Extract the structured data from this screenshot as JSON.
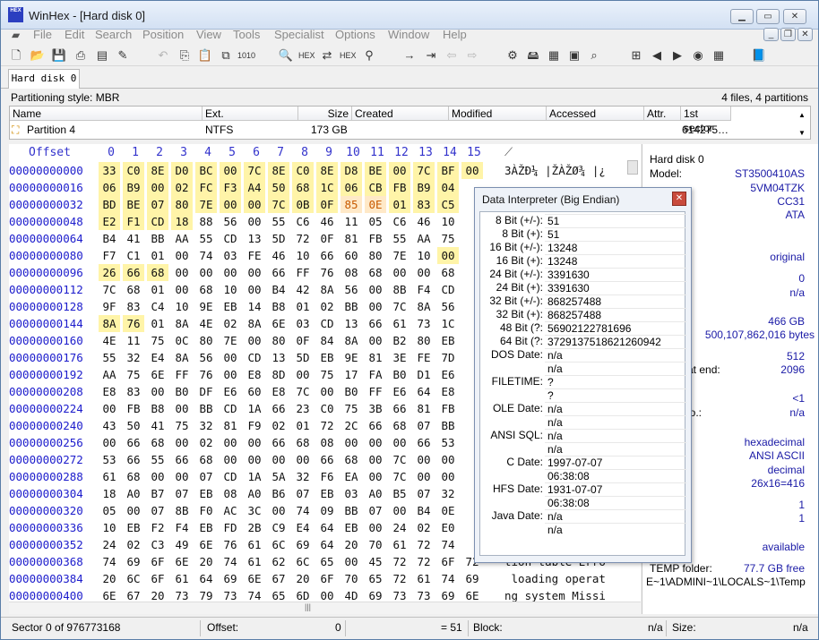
{
  "window": {
    "title": "WinHex - [Hard disk 0]",
    "logo_text": "HEX"
  },
  "menu": [
    "File",
    "Edit",
    "Search",
    "Position",
    "View",
    "Tools",
    "Specialist",
    "Options",
    "Window",
    "Help"
  ],
  "tab": {
    "label": "Hard disk 0"
  },
  "partition_info": {
    "style": "Partitioning style: MBR",
    "count": "4 files, 4 partitions"
  },
  "file_table": {
    "columns": [
      "Name",
      "Ext.",
      "Size",
      "Created",
      "Modified",
      "Accessed",
      "Attr.",
      "1st sector"
    ],
    "row": {
      "name": "Partition 4",
      "ext": "NTFS",
      "size": "173 GB",
      "first_sector": "614275…"
    }
  },
  "hex": {
    "header": {
      "offset": "Offset",
      "cols": [
        "0",
        "1",
        "2",
        "3",
        "4",
        "5",
        "6",
        "7",
        "8",
        "9",
        "10",
        "11",
        "12",
        "13",
        "14",
        "15"
      ]
    },
    "rows": [
      {
        "off": "00000000000",
        "bytes": [
          "33",
          "C0",
          "8E",
          "D0",
          "BC",
          "00",
          "7C",
          "8E",
          "C0",
          "8E",
          "D8",
          "BE",
          "00",
          "7C",
          "BF",
          "00"
        ],
        "ascii": "3ÀŽÐ¼ |ŽÀŽØ¾ |¿"
      },
      {
        "off": "00000000016",
        "bytes": [
          "06",
          "B9",
          "00",
          "02",
          "FC",
          "F3",
          "A4",
          "50",
          "68",
          "1C",
          "06",
          "CB",
          "FB",
          "B9",
          "04",
          ""
        ],
        "ascii": ""
      },
      {
        "off": "00000000032",
        "bytes": [
          "BD",
          "BE",
          "07",
          "80",
          "7E",
          "00",
          "00",
          "7C",
          "0B",
          "0F",
          "85",
          "0E",
          "01",
          "83",
          "C5",
          ""
        ],
        "ascii": ""
      },
      {
        "off": "00000000048",
        "bytes": [
          "E2",
          "F1",
          "CD",
          "18",
          "88",
          "56",
          "00",
          "55",
          "C6",
          "46",
          "11",
          "05",
          "C6",
          "46",
          "10",
          ""
        ],
        "ascii": ""
      },
      {
        "off": "00000000064",
        "bytes": [
          "B4",
          "41",
          "BB",
          "AA",
          "55",
          "CD",
          "13",
          "5D",
          "72",
          "0F",
          "81",
          "FB",
          "55",
          "AA",
          "75",
          ""
        ],
        "ascii": ""
      },
      {
        "off": "00000000080",
        "bytes": [
          "F7",
          "C1",
          "01",
          "00",
          "74",
          "03",
          "FE",
          "46",
          "10",
          "66",
          "60",
          "80",
          "7E",
          "10",
          "00",
          ""
        ],
        "ascii": ""
      },
      {
        "off": "00000000096",
        "bytes": [
          "26",
          "66",
          "68",
          "00",
          "00",
          "00",
          "00",
          "66",
          "FF",
          "76",
          "08",
          "68",
          "00",
          "00",
          "68",
          ""
        ],
        "ascii": ""
      },
      {
        "off": "00000000112",
        "bytes": [
          "7C",
          "68",
          "01",
          "00",
          "68",
          "10",
          "00",
          "B4",
          "42",
          "8A",
          "56",
          "00",
          "8B",
          "F4",
          "CD",
          ""
        ],
        "ascii": ""
      },
      {
        "off": "00000000128",
        "bytes": [
          "9F",
          "83",
          "C4",
          "10",
          "9E",
          "EB",
          "14",
          "B8",
          "01",
          "02",
          "BB",
          "00",
          "7C",
          "8A",
          "56",
          ""
        ],
        "ascii": ""
      },
      {
        "off": "00000000144",
        "bytes": [
          "8A",
          "76",
          "01",
          "8A",
          "4E",
          "02",
          "8A",
          "6E",
          "03",
          "CD",
          "13",
          "66",
          "61",
          "73",
          "1C",
          ""
        ],
        "ascii": ""
      },
      {
        "off": "00000000160",
        "bytes": [
          "4E",
          "11",
          "75",
          "0C",
          "80",
          "7E",
          "00",
          "80",
          "0F",
          "84",
          "8A",
          "00",
          "B2",
          "80",
          "EB",
          ""
        ],
        "ascii": ""
      },
      {
        "off": "00000000176",
        "bytes": [
          "55",
          "32",
          "E4",
          "8A",
          "56",
          "00",
          "CD",
          "13",
          "5D",
          "EB",
          "9E",
          "81",
          "3E",
          "FE",
          "7D",
          ""
        ],
        "ascii": ""
      },
      {
        "off": "00000000192",
        "bytes": [
          "AA",
          "75",
          "6E",
          "FF",
          "76",
          "00",
          "E8",
          "8D",
          "00",
          "75",
          "17",
          "FA",
          "B0",
          "D1",
          "E6",
          ""
        ],
        "ascii": ""
      },
      {
        "off": "00000000208",
        "bytes": [
          "E8",
          "83",
          "00",
          "B0",
          "DF",
          "E6",
          "60",
          "E8",
          "7C",
          "00",
          "B0",
          "FF",
          "E6",
          "64",
          "E8",
          ""
        ],
        "ascii": ""
      },
      {
        "off": "00000000224",
        "bytes": [
          "00",
          "FB",
          "B8",
          "00",
          "BB",
          "CD",
          "1A",
          "66",
          "23",
          "C0",
          "75",
          "3B",
          "66",
          "81",
          "FB",
          ""
        ],
        "ascii": ""
      },
      {
        "off": "00000000240",
        "bytes": [
          "43",
          "50",
          "41",
          "75",
          "32",
          "81",
          "F9",
          "02",
          "01",
          "72",
          "2C",
          "66",
          "68",
          "07",
          "BB",
          ""
        ],
        "ascii": ""
      },
      {
        "off": "00000000256",
        "bytes": [
          "00",
          "66",
          "68",
          "00",
          "02",
          "00",
          "00",
          "66",
          "68",
          "08",
          "00",
          "00",
          "00",
          "66",
          "53",
          ""
        ],
        "ascii": ""
      },
      {
        "off": "00000000272",
        "bytes": [
          "53",
          "66",
          "55",
          "66",
          "68",
          "00",
          "00",
          "00",
          "00",
          "66",
          "68",
          "00",
          "7C",
          "00",
          "00",
          ""
        ],
        "ascii": ""
      },
      {
        "off": "00000000288",
        "bytes": [
          "61",
          "68",
          "00",
          "00",
          "07",
          "CD",
          "1A",
          "5A",
          "32",
          "F6",
          "EA",
          "00",
          "7C",
          "00",
          "00",
          ""
        ],
        "ascii": ""
      },
      {
        "off": "00000000304",
        "bytes": [
          "18",
          "A0",
          "B7",
          "07",
          "EB",
          "08",
          "A0",
          "B6",
          "07",
          "EB",
          "03",
          "A0",
          "B5",
          "07",
          "32",
          ""
        ],
        "ascii": ""
      },
      {
        "off": "00000000320",
        "bytes": [
          "05",
          "00",
          "07",
          "8B",
          "F0",
          "AC",
          "3C",
          "00",
          "74",
          "09",
          "BB",
          "07",
          "00",
          "B4",
          "0E",
          ""
        ],
        "ascii": ""
      },
      {
        "off": "00000000336",
        "bytes": [
          "10",
          "EB",
          "F2",
          "F4",
          "EB",
          "FD",
          "2B",
          "C9",
          "E4",
          "64",
          "EB",
          "00",
          "24",
          "02",
          "E0",
          ""
        ],
        "ascii": ""
      },
      {
        "off": "00000000352",
        "bytes": [
          "24",
          "02",
          "C3",
          "49",
          "6E",
          "76",
          "61",
          "6C",
          "69",
          "64",
          "20",
          "70",
          "61",
          "72",
          "74",
          ""
        ],
        "ascii": ""
      },
      {
        "off": "00000000368",
        "bytes": [
          "74",
          "69",
          "6F",
          "6E",
          "20",
          "74",
          "61",
          "62",
          "6C",
          "65",
          "00",
          "45",
          "72",
          "72",
          "6F",
          "72"
        ],
        "ascii": "tion table Erro"
      },
      {
        "off": "00000000384",
        "bytes": [
          "20",
          "6C",
          "6F",
          "61",
          "64",
          "69",
          "6E",
          "67",
          "20",
          "6F",
          "70",
          "65",
          "72",
          "61",
          "74",
          "69"
        ],
        "ascii": " loading operat"
      },
      {
        "off": "00000000400",
        "bytes": [
          "6E",
          "67",
          "20",
          "73",
          "79",
          "73",
          "74",
          "65",
          "6D",
          "00",
          "4D",
          "69",
          "73",
          "73",
          "69",
          "6E"
        ],
        "ascii": "ng system Missi"
      }
    ]
  },
  "info": [
    {
      "label": "Hard disk 0",
      "value": ""
    },
    {
      "label": "Model:",
      "value": "ST3500410AS"
    },
    {
      "label": "",
      "value": "5VM04TZK"
    },
    {
      "label": "Rev.:",
      "value": "CC31"
    },
    {
      "label": "",
      "value": "ATA"
    },
    {
      "label": "dit Mode",
      "value": ""
    },
    {
      "label": "",
      "value": "original"
    },
    {
      "label": "el:",
      "value": "0"
    },
    {
      "label": "erses:",
      "value": "n/a"
    },
    {
      "label": "acity:",
      "value": "466 GB"
    },
    {
      "label": "",
      "value": "500,107,862,016 bytes"
    },
    {
      "label": "sector:",
      "value": "512"
    },
    {
      "label": "sectors at end:",
      "value": "2096"
    },
    {
      "label": "",
      "value": "<1"
    },
    {
      "label": "sector No.:",
      "value": "n/a"
    },
    {
      "label": "",
      "value": "hexadecimal"
    },
    {
      "label": "r set:",
      "value": "ANSI ASCII"
    },
    {
      "label": "",
      "value": "decimal"
    },
    {
      "label": "page:",
      "value": "26x16=416"
    },
    {
      "label": "#:",
      "value": "1"
    },
    {
      "label": "ndows:",
      "value": "1"
    },
    {
      "label": "d:",
      "value": "available"
    },
    {
      "label": "TEMP folder:",
      "value": "77.7 GB free"
    },
    {
      "label": "E~1\\ADMINI~1\\LOCALS~1\\Temp",
      "value": ""
    }
  ],
  "interpreter": {
    "title": "Data Interpreter (Big Endian)",
    "rows": [
      {
        "label": "8 Bit (+/-):",
        "value": "51"
      },
      {
        "label": "8 Bit (+):",
        "value": "51"
      },
      {
        "label": "16 Bit (+/-):",
        "value": "13248"
      },
      {
        "label": "16 Bit (+):",
        "value": "13248"
      },
      {
        "label": "24 Bit (+/-):",
        "value": "3391630"
      },
      {
        "label": "24 Bit (+):",
        "value": "3391630"
      },
      {
        "label": "32 Bit (+/-):",
        "value": "868257488"
      },
      {
        "label": "32 Bit (+):",
        "value": "868257488"
      },
      {
        "label": "48 Bit (?:",
        "value": "56902122781696"
      },
      {
        "label": "64 Bit (?:",
        "value": "3729137518621260942"
      },
      {
        "label": "DOS Date:",
        "value": "n/a"
      },
      {
        "label": "",
        "value": "n/a"
      },
      {
        "label": "FILETIME:",
        "value": "?"
      },
      {
        "label": "",
        "value": "?"
      },
      {
        "label": "OLE Date:",
        "value": "n/a"
      },
      {
        "label": "",
        "value": "n/a"
      },
      {
        "label": "ANSI SQL:",
        "value": "n/a"
      },
      {
        "label": "",
        "value": "n/a"
      },
      {
        "label": "C Date:",
        "value": "1997-07-07"
      },
      {
        "label": "",
        "value": "06:38:08"
      },
      {
        "label": "HFS Date:",
        "value": "1931-07-07"
      },
      {
        "label": "",
        "value": "06:38:08"
      },
      {
        "label": "Java Date:",
        "value": "n/a"
      },
      {
        "label": "",
        "value": "n/a"
      }
    ]
  },
  "status": {
    "sector": "Sector 0 of 976773168",
    "offset_label": "Offset:",
    "offset_value": "0",
    "value": "= 51",
    "block_label": "Block:",
    "block_value": "n/a",
    "size_label": "Size:",
    "size_value": "n/a"
  }
}
